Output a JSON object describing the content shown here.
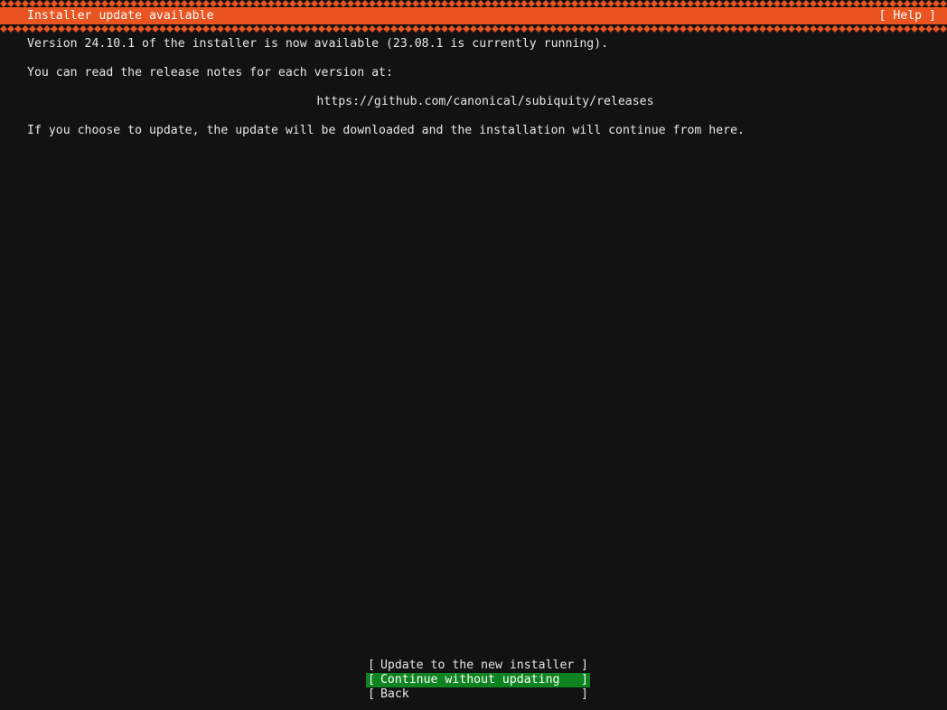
{
  "header": {
    "title": "Installer update available",
    "help_label": "[ Help ]"
  },
  "body": {
    "line1": "Version 24.10.1 of the installer is now available (23.08.1 is currently running).",
    "line2": "You can read the release notes for each version at:",
    "url": "https://github.com/canonical/subiquity/releases",
    "line3": "If you choose to update, the update will be downloaded and the installation will continue from here."
  },
  "buttons": [
    {
      "label": "Update to the new installer",
      "focused": false
    },
    {
      "label": "Continue without updating",
      "focused": true
    },
    {
      "label": "Back",
      "focused": false
    }
  ],
  "colors": {
    "accent": "#E95420",
    "focus": "#0E8420",
    "background": "#121212",
    "text": "#e6e6e6"
  }
}
